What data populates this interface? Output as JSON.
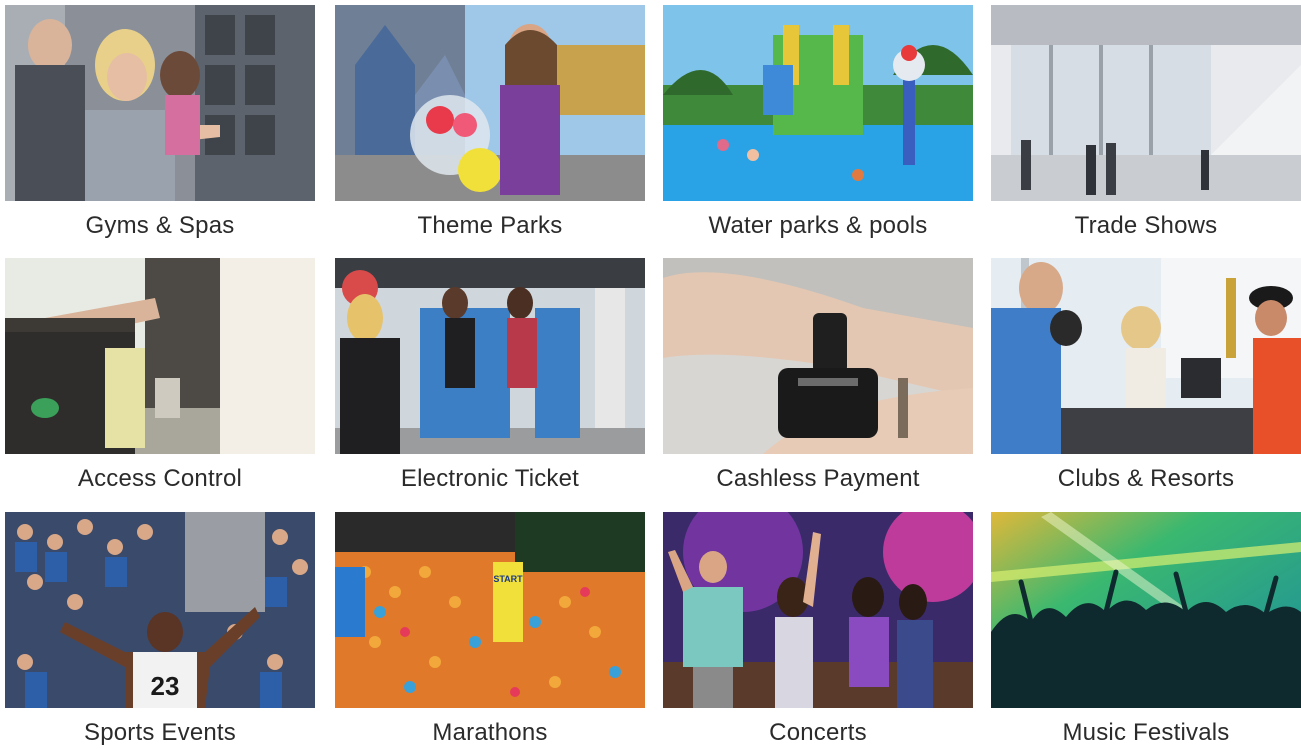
{
  "tiles": [
    {
      "id": "gyms-spas",
      "label": "Gyms & Spas"
    },
    {
      "id": "theme-parks",
      "label": "Theme Parks"
    },
    {
      "id": "water-parks",
      "label": "Water parks & pools"
    },
    {
      "id": "trade-shows",
      "label": "Trade Shows"
    },
    {
      "id": "access-control",
      "label": "Access Control"
    },
    {
      "id": "electronic-ticket",
      "label": "Electronic Ticket"
    },
    {
      "id": "cashless-payment",
      "label": "Cashless Payment"
    },
    {
      "id": "clubs-resorts",
      "label": "Clubs & Resorts"
    },
    {
      "id": "sports-events",
      "label": "Sports Events"
    },
    {
      "id": "marathons",
      "label": "Marathons"
    },
    {
      "id": "concerts",
      "label": "Concerts"
    },
    {
      "id": "music-festivals",
      "label": "Music Festivals"
    }
  ],
  "photo_text": {
    "jersey_number": "23",
    "marathon_banner": "START"
  }
}
